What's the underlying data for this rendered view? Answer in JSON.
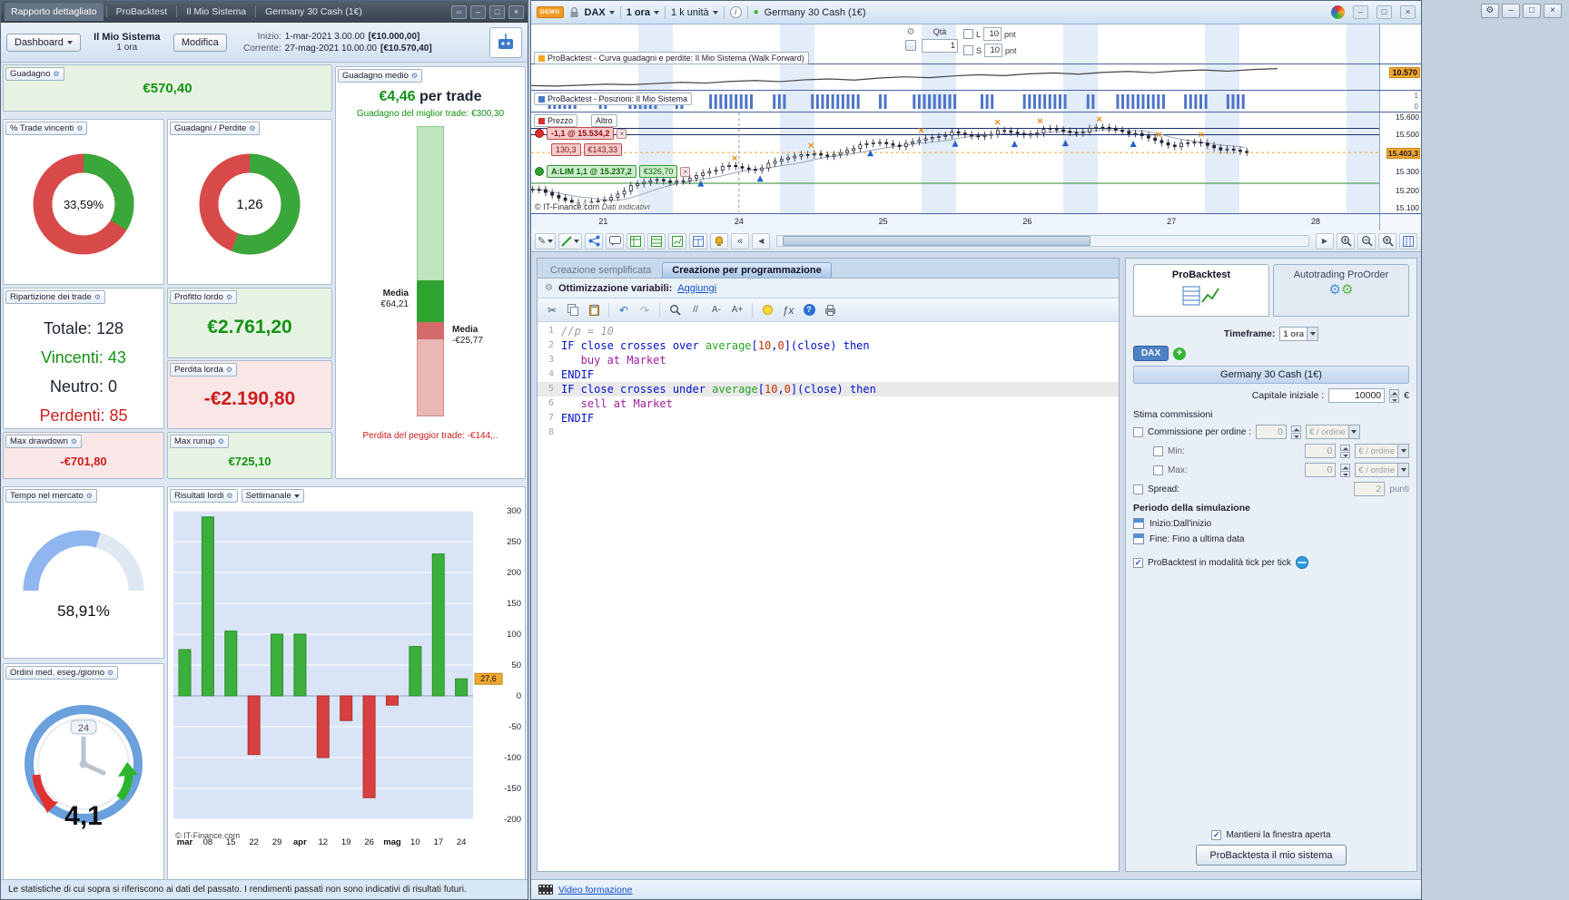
{
  "icons": {
    "cut": "✂",
    "undo": "↶",
    "redo": "↷",
    "font_small": "A-",
    "font_big": "A+",
    "fx": "ƒx",
    "help": "?",
    "comment": "//",
    "min": "–",
    "max": "□",
    "close": "×",
    "collapse": "«",
    "left": "◀",
    "right": "▶",
    "check": "✓",
    "plus": "+",
    "info": "i",
    "pencil": "✎",
    "wrench": "⚙",
    "dot": "●",
    "gear": "⚙"
  },
  "left_window": {
    "titlebar": {
      "tabs": [
        "Rapporto dettagliato",
        "ProBacktest",
        "Il Mio Sistema",
        "Germany 30 Cash (1€)"
      ]
    },
    "header": {
      "dashboard_button": "Dashboard",
      "system_name": "Il Mio Sistema",
      "system_timeframe": "1 ora",
      "modify_button": "Modifica",
      "start_label": "Inizio:",
      "start_value": "1-mar-2021 3.00.00",
      "start_equity": "[€10.000,00]",
      "current_label": "Corrente:",
      "current_value": "27-mag-2021 10.00.00",
      "current_equity": "[€10.570,40]"
    },
    "panels": {
      "gain": {
        "title": "Guadagno",
        "value": "€570,40"
      },
      "win_rate": {
        "title": "% Trade vincenti",
        "value": "33,59%"
      },
      "gain_loss": {
        "title": "Guadagni / Perdite",
        "value": "1,26"
      },
      "avg_gain": {
        "title": "Guadagno medio",
        "value": "€4,46",
        "suffix": " per trade",
        "best": "Guadagno del miglior trade: €300,30",
        "win_label": "Media",
        "win_value": "€64,21",
        "loss_label": "Media",
        "loss_value": "-€25,77",
        "worst": "Perdita del peggior trade: -€144,.."
      },
      "breakdown": {
        "title": "Ripartizione dei trade",
        "rows": [
          {
            "label": "Totale:",
            "value": "128"
          },
          {
            "label": "Vincenti:",
            "value": "43"
          },
          {
            "label": "Neutro:",
            "value": "0"
          },
          {
            "label": "Perdenti:",
            "value": "85"
          }
        ]
      },
      "gross_profit": {
        "title": "Profitto lordo",
        "value": "€2.761,20"
      },
      "gross_loss": {
        "title": "Perdita lorda",
        "value": "-€2.190,80"
      },
      "max_drawdown": {
        "title": "Max drawdown",
        "value": "-€701,80"
      },
      "max_runup": {
        "title": "Max runup",
        "value": "€725,10"
      },
      "time_in_market": {
        "title": "Tempo nel mercato",
        "value": "58,91%"
      },
      "orders_per_day": {
        "title": "Ordini med. eseg./giorno",
        "value": "4,1",
        "clock_label": "24"
      },
      "weekly": {
        "title": "Risultati lordi",
        "period": "Settimanale",
        "copyright": "© IT-Finance.com"
      }
    },
    "disclaimer": "Le statistiche di cui sopra si riferiscono ai dati del passato. I rendimenti passati non sono indicativi di risultati futuri."
  },
  "right_window": {
    "titlebar": {
      "demo": "DEMO",
      "instrument": "DAX",
      "timeframe": "1 ora",
      "units": "1 k unità",
      "feed": "Germany 30 Cash (1€)"
    },
    "order_widget": {
      "qty_label": "Qtà",
      "qty_value": "1",
      "l_label": "L",
      "l_value": "10",
      "l_unit": "pnt",
      "s_label": "S",
      "s_value": "10",
      "s_unit": "pnt"
    },
    "chart": {
      "equity_title": "ProBacktest - Curva guadagni e perdite: Il Mio Sistema (Walk Forward)",
      "equity_scale": "10.570",
      "positions_title": "ProBacktest - Posizioni: Il Mio Sistema",
      "pos_scale_top": "1",
      "pos_scale_bottom": "0",
      "price_tab": "Prezzo",
      "other_tab": "Altro",
      "sell_order": "-1,1 @ 15.534,2",
      "sell_points": "130,3",
      "sell_value": "€143,33",
      "buy_order": "A:LIM  1,1 @ 15.237,2",
      "buy_value": "€326,70",
      "copyright": "© IT-Finance.com",
      "indicative": "Dati indicativi"
    },
    "editor": {
      "tab_simple": "Creazione semplificata",
      "tab_program": "Creazione per programmazione",
      "opt_label": "Ottimizzazione variabili:",
      "opt_add": "Aggiungi",
      "code_lines": [
        {
          "n": "1",
          "tokens": [
            [
              "//p = 10",
              "cm"
            ]
          ]
        },
        {
          "n": "2",
          "tokens": [
            [
              "IF close crosses over ",
              "kw"
            ],
            [
              "average",
              "fn"
            ],
            [
              "[",
              "kw"
            ],
            [
              "10",
              "nm"
            ],
            [
              ",",
              "kw"
            ],
            [
              "0",
              "nm"
            ],
            [
              "](close) ",
              "kw"
            ],
            [
              "then",
              "kw"
            ]
          ]
        },
        {
          "n": "3",
          "tokens": [
            [
              "   buy at Market",
              "ac"
            ]
          ]
        },
        {
          "n": "4",
          "tokens": [
            [
              "ENDIF",
              "kw"
            ]
          ]
        },
        {
          "n": "5",
          "tokens": [
            [
              "IF close crosses under ",
              "kw"
            ],
            [
              "average",
              "fn"
            ],
            [
              "[",
              "kw"
            ],
            [
              "10",
              "nm"
            ],
            [
              ",",
              "kw"
            ],
            [
              "0",
              "nm"
            ],
            [
              "](close) ",
              "kw"
            ],
            [
              "then",
              "kw"
            ]
          ]
        },
        {
          "n": "6",
          "tokens": [
            [
              "   sell at Market",
              "ac"
            ]
          ]
        },
        {
          "n": "7",
          "tokens": [
            [
              "ENDIF",
              "kw"
            ]
          ]
        },
        {
          "n": "8",
          "tokens": []
        }
      ]
    },
    "settings": {
      "tab_backtest": "ProBacktest",
      "tab_proorder": "Autotrading ProOrder",
      "timeframe_label": "Timeframe:",
      "timeframe_value": "1 ora",
      "chip": "DAX",
      "instrument": "Germany 30 Cash (1€)",
      "capital_label": "Capitale iniziale :",
      "capital_value": "10000",
      "capital_unit": "€",
      "commissions": "Stima commissioni",
      "commission_label": "Commissione per ordine :",
      "commission_value": "0",
      "per_order": "€ / ordine",
      "min_label": "Min:",
      "min_value": "0",
      "max_label": "Max:",
      "max_value": "0",
      "spread_label": "Spread:",
      "spread_value": "2",
      "spread_unit": "punti",
      "period_title": "Periodo della simulazione",
      "period_start": "Inizio:Dall'inizio",
      "period_end": "Fine: Fino a ultima data",
      "tick_label": "ProBacktest in modalità tick per tick",
      "keep_open": "Mantieni la finestra aperta",
      "run_button": "ProBacktesta il mio sistema"
    },
    "statusbar": {
      "video_link": "Video formazione"
    }
  },
  "chart_data": [
    {
      "type": "pie",
      "title": "% Trade vincenti",
      "labels": [
        "Vincenti",
        "Perdenti"
      ],
      "values": [
        33.59,
        66.41
      ],
      "colors": [
        "#3aa73a",
        "#d84a4a"
      ],
      "center_label": "33,59%"
    },
    {
      "type": "pie",
      "title": "Guadagni / Perdite",
      "labels": [
        "Guadagni",
        "Perdite"
      ],
      "values": [
        55.8,
        44.2
      ],
      "ratio": 1.26,
      "colors": [
        "#3aa73a",
        "#d84a4a"
      ],
      "center_label": "1,26"
    },
    {
      "type": "bar",
      "title": "Guadagno medio per trade",
      "avg_per_trade": 4.46,
      "best_trade": 300.3,
      "avg_win": 64.21,
      "avg_loss": -25.77,
      "worst_trade": -144,
      "currency": "EUR"
    },
    {
      "type": "gauge",
      "title": "Tempo nel mercato",
      "value": 58.91,
      "max": 100
    },
    {
      "type": "bar",
      "title": "Risultati lordi (Settimanale)",
      "categories": [
        "mar",
        "08",
        "15",
        "22",
        "29",
        "apr",
        "12",
        "19",
        "26",
        "mag",
        "10",
        "17",
        "24"
      ],
      "values": [
        75,
        290,
        105,
        -95,
        100,
        100,
        -100,
        -40,
        -165,
        -15,
        80,
        230,
        27.6
      ],
      "bold_categories": [
        "mar",
        "apr",
        "mag"
      ],
      "ylim": [
        -200,
        300
      ],
      "yticks": [
        300,
        250,
        200,
        150,
        100,
        50,
        0,
        -50,
        -100,
        -150,
        -200
      ],
      "latest_label": "27,6",
      "grid": true,
      "legend": "none"
    },
    {
      "type": "line",
      "title": "ProBacktest - Curva guadagni e perdite: Il Mio Sistema (Walk Forward)",
      "values": [
        10000,
        9985,
        10015,
        10050,
        10030,
        10070,
        10110,
        10085,
        10140,
        10170,
        10135,
        10195,
        10225,
        10185,
        10255,
        10295,
        10265,
        10325,
        10365,
        10335,
        10395,
        10425,
        10385,
        10445,
        10475,
        10435,
        10495,
        10525,
        10485,
        10540,
        10570
      ],
      "ylim": [
        9950,
        10620
      ],
      "last_label": "10.570"
    },
    {
      "type": "bar",
      "title": "ProBacktest - Posizioni: Il Mio Sistema",
      "range": [
        0,
        1
      ],
      "blocks": [
        [
          0.02,
          0.055
        ],
        [
          0.08,
          0.09
        ],
        [
          0.115,
          0.15
        ],
        [
          0.17,
          0.18
        ],
        [
          0.21,
          0.26
        ],
        [
          0.285,
          0.3
        ],
        [
          0.33,
          0.39
        ],
        [
          0.41,
          0.42
        ],
        [
          0.45,
          0.5
        ],
        [
          0.53,
          0.545
        ],
        [
          0.58,
          0.63
        ],
        [
          0.655,
          0.665
        ],
        [
          0.69,
          0.745
        ],
        [
          0.77,
          0.8
        ],
        [
          0.82,
          0.84
        ]
      ]
    },
    {
      "type": "candlestick",
      "title": "Prezzo — Germany 30 Cash (1€), 1 ora",
      "ylim": [
        15080,
        15620
      ],
      "yticks": [
        "15.600",
        "15.500",
        "15.403,3",
        "15.300",
        "15.200",
        "15.100"
      ],
      "ytick_values": [
        15600,
        15500,
        15403.3,
        15300,
        15200,
        15100
      ],
      "current_price": 15403.3,
      "closes": [
        15210,
        15160,
        15120,
        15150,
        15220,
        15260,
        15240,
        15300,
        15330,
        15310,
        15360,
        15400,
        15380,
        15430,
        15460,
        15440,
        15480,
        15510,
        15490,
        15520,
        15500,
        15530,
        15510,
        15540,
        15520,
        15480,
        15440,
        15460,
        15420,
        15403.3
      ],
      "x_labels": [
        "21",
        "24",
        "25",
        "26",
        "27",
        "28"
      ],
      "x_positions": [
        0.085,
        0.245,
        0.415,
        0.585,
        0.755,
        0.925
      ],
      "sell_level": 15534.2,
      "buy_level": 15237.2,
      "extra_level": 15500,
      "vline": 0.245,
      "buy_arrows": [
        0.2,
        0.27,
        0.4,
        0.5,
        0.57,
        0.63,
        0.71
      ],
      "sell_marks": [
        0.24,
        0.33,
        0.46,
        0.55,
        0.6,
        0.67,
        0.74,
        0.79
      ],
      "data_extent": 0.85
    }
  ]
}
